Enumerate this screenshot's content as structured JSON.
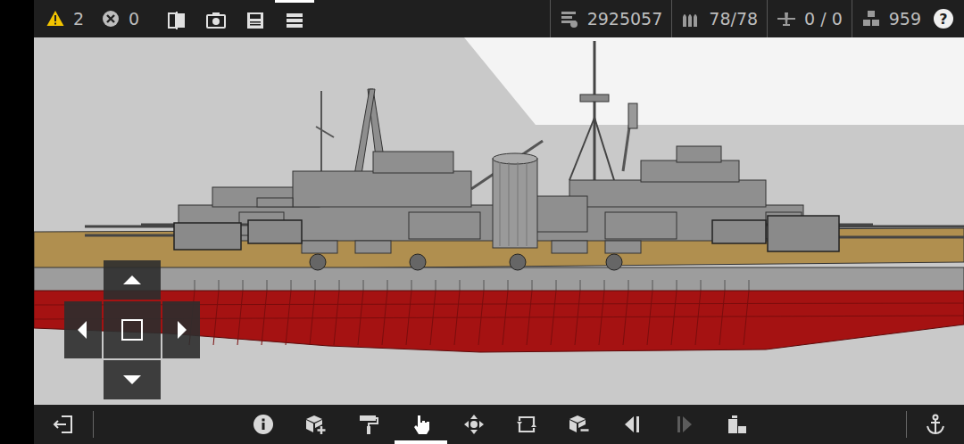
{
  "top_bar": {
    "alerts": [
      {
        "kind": "warning",
        "count": "2"
      },
      {
        "kind": "error",
        "count": "0"
      }
    ],
    "tools": [
      {
        "kind": "split-view",
        "selected": false
      },
      {
        "kind": "screenshot",
        "selected": false
      },
      {
        "kind": "save",
        "selected": false
      },
      {
        "kind": "menu",
        "selected": true
      }
    ],
    "stats": [
      {
        "kind": "displacement",
        "value": "2925057"
      },
      {
        "kind": "ammo",
        "value": "78/78"
      },
      {
        "kind": "aircraft",
        "value": "0 / 0"
      },
      {
        "kind": "parts",
        "value": "959"
      }
    ],
    "help": "?"
  },
  "bottom_bar": {
    "tools": [
      {
        "kind": "info",
        "selected": false,
        "disabled": false
      },
      {
        "kind": "add-block",
        "selected": false,
        "disabled": false
      },
      {
        "kind": "paint",
        "selected": false,
        "disabled": false
      },
      {
        "kind": "hand",
        "selected": true,
        "disabled": false
      },
      {
        "kind": "move",
        "selected": false,
        "disabled": false
      },
      {
        "kind": "rotate",
        "selected": false,
        "disabled": false
      },
      {
        "kind": "remove-block",
        "selected": false,
        "disabled": false
      },
      {
        "kind": "mirror-left",
        "selected": false,
        "disabled": false
      },
      {
        "kind": "mirror-right",
        "selected": false,
        "disabled": true
      },
      {
        "kind": "layers",
        "selected": false,
        "disabled": false
      }
    ]
  }
}
